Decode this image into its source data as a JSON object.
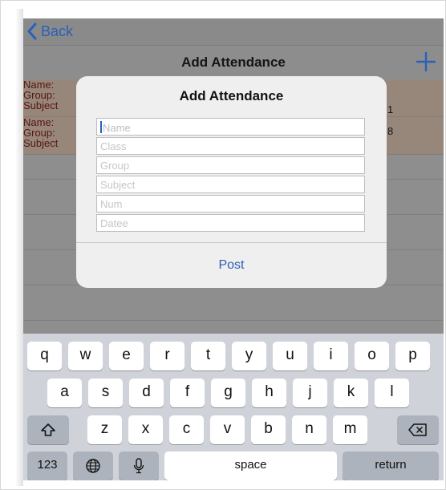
{
  "nav": {
    "back_label": "Back",
    "title": "Add Attendance",
    "add_icon": "plus-icon"
  },
  "list": {
    "rows": [
      {
        "lines": [
          "Name:",
          "Group:",
          "Subject"
        ],
        "value": "1"
      },
      {
        "lines": [
          "Name:",
          "Group:",
          "Subject"
        ],
        "value": "8"
      }
    ]
  },
  "dialog": {
    "title": "Add Attendance",
    "fields": [
      {
        "placeholder": "Name",
        "value": ""
      },
      {
        "placeholder": "Class",
        "value": ""
      },
      {
        "placeholder": "Group",
        "value": ""
      },
      {
        "placeholder": "Subject",
        "value": ""
      },
      {
        "placeholder": "Num",
        "value": ""
      },
      {
        "placeholder": "Datee",
        "value": ""
      }
    ],
    "post_label": "Post"
  },
  "keyboard": {
    "row1": [
      "q",
      "w",
      "e",
      "r",
      "t",
      "y",
      "u",
      "i",
      "o",
      "p"
    ],
    "row2": [
      "a",
      "s",
      "d",
      "f",
      "g",
      "h",
      "j",
      "k",
      "l"
    ],
    "row3": [
      "z",
      "x",
      "c",
      "v",
      "b",
      "n",
      "m"
    ],
    "numbers_label": "123",
    "space_label": "space",
    "return_label": "return",
    "shift_icon": "shift-icon",
    "delete_icon": "backspace-icon",
    "globe_icon": "globe-icon",
    "mic_icon": "microphone-icon"
  },
  "colors": {
    "accent": "#2a60b8",
    "row_bg": "#96877a",
    "row_text": "#5a1313",
    "dim_overlay": "#8e8e8e",
    "keyboard_bg": "#cfd3d9"
  }
}
